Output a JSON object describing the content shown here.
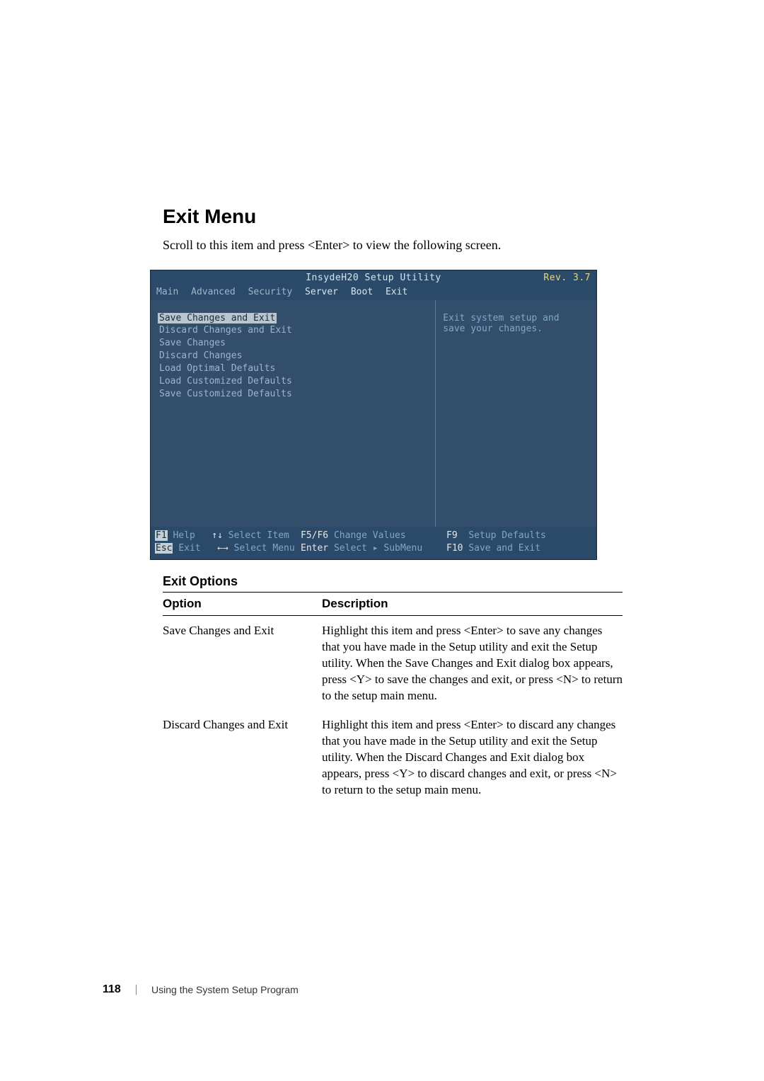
{
  "heading": "Exit Menu",
  "intro": "Scroll to this item and press <Enter> to view the following screen.",
  "bios": {
    "title": "InsydeH20 Setup Utility",
    "rev": "Rev. 3.7",
    "tabs": [
      "Main",
      "Advanced",
      "Security",
      "Server",
      "Boot",
      "Exit"
    ],
    "active_tab": "Exit",
    "items": [
      "Save Changes and Exit",
      "Discard Changes and Exit",
      "Save Changes",
      "Discard Changes",
      "Load Optimal Defaults",
      "Load Customized Defaults",
      "Save Customized Defaults"
    ],
    "selected_index": 0,
    "help_text_1": "Exit system setup and",
    "help_text_2": "save your changes.",
    "footer": {
      "f1": "F1",
      "f1_lbl": "Help",
      "esc": "Esc",
      "esc_lbl": "Exit",
      "updn": "↑↓",
      "updn_lbl": "Select Item",
      "lr": "←→",
      "lr_lbl": "Select Menu",
      "f56": "F5/F6",
      "f56_lbl": "Change Values",
      "enter": "Enter",
      "enter_lbl": "Select ▸ SubMenu",
      "f9": "F9",
      "f9_lbl": "Setup Defaults",
      "f10": "F10",
      "f10_lbl": "Save and Exit"
    }
  },
  "table": {
    "title": "Exit Options",
    "headers": [
      "Option",
      "Description"
    ],
    "rows": [
      {
        "option": "Save Changes and Exit",
        "desc": "Highlight this item and press <Enter> to save any changes that you have made in the Setup utility and exit the Setup utility. When the Save Changes and Exit dialog box appears, press <Y> to save the changes and exit, or press <N> to return to the setup main menu."
      },
      {
        "option": "Discard Changes and Exit",
        "desc": "Highlight this item and press <Enter> to discard any changes that you have made in the Setup utility and exit the Setup utility. When the Discard Changes and Exit dialog box appears, press <Y> to discard changes and exit, or press <N> to return to the setup main menu."
      }
    ]
  },
  "page_footer": {
    "number": "118",
    "separator": "|",
    "label": "Using the System Setup Program"
  }
}
